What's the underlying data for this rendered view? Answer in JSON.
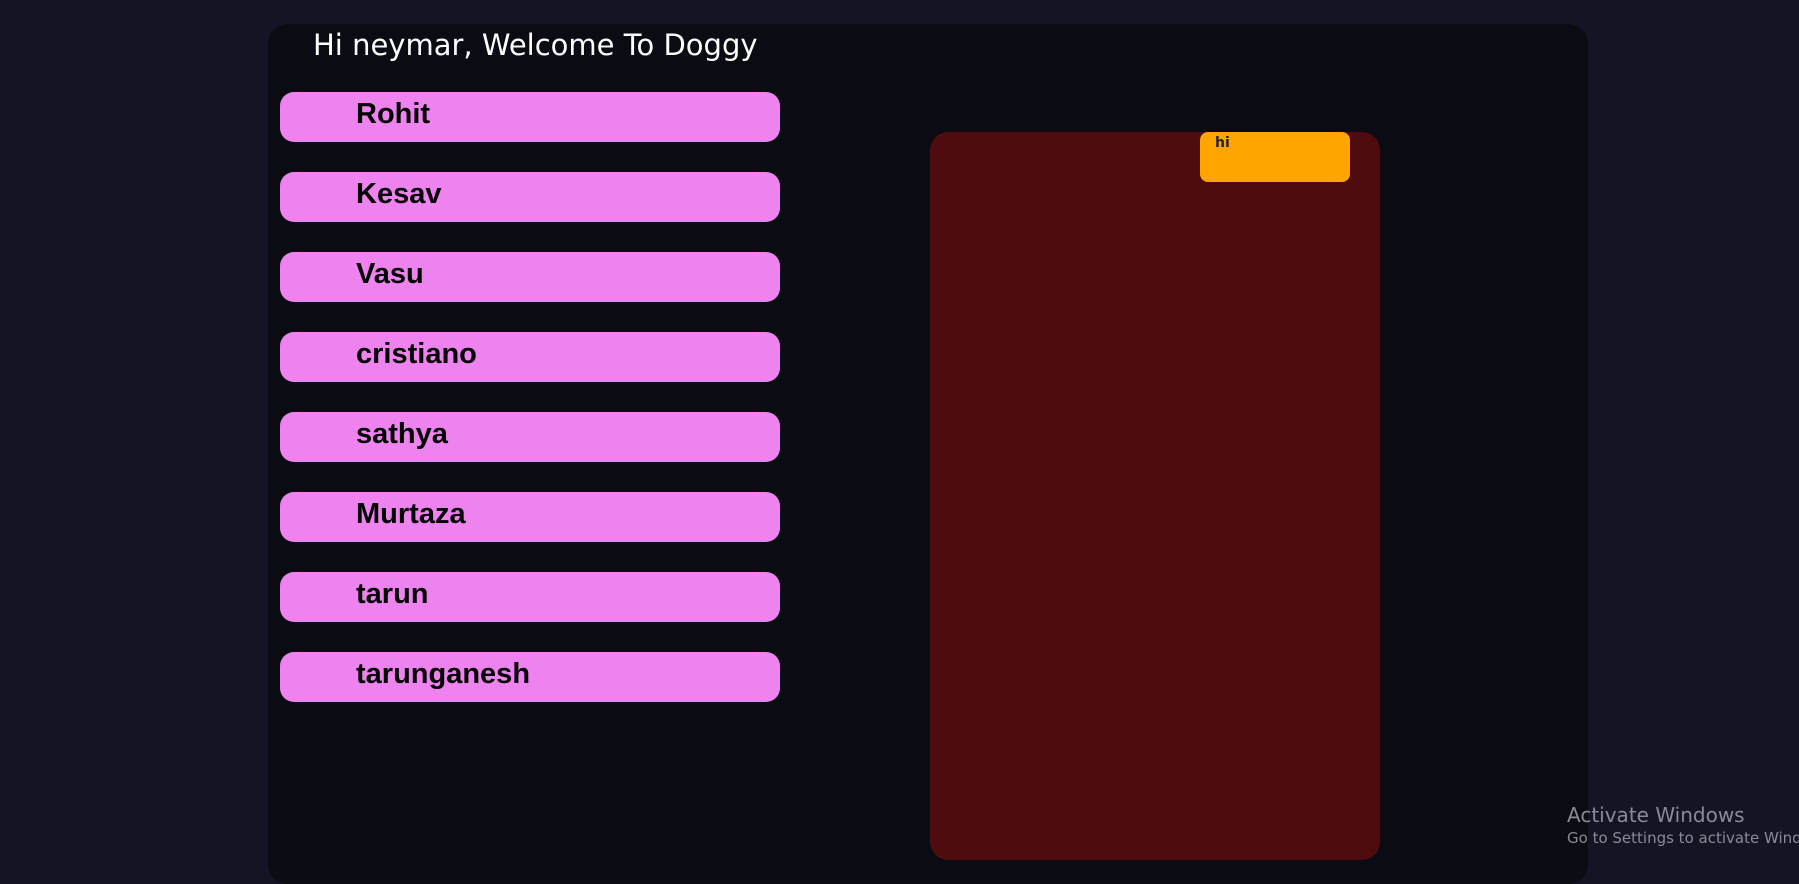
{
  "header": {
    "title": "Hi neymar, Welcome To Doggy"
  },
  "contacts": [
    {
      "name": "Rohit"
    },
    {
      "name": "Kesav"
    },
    {
      "name": "Vasu"
    },
    {
      "name": "cristiano"
    },
    {
      "name": "sathya"
    },
    {
      "name": "Murtaza"
    },
    {
      "name": "tarun"
    },
    {
      "name": "tarunganesh"
    }
  ],
  "chat": {
    "messages": [
      {
        "text": "hi"
      }
    ]
  },
  "watermark": {
    "line1": "Activate Windows",
    "line2": "Go to Settings to activate Windows."
  },
  "colors": {
    "contact_bg": "#ee82ee",
    "chat_bg": "#4e0c0e",
    "bubble_bg": "#ffa500"
  }
}
